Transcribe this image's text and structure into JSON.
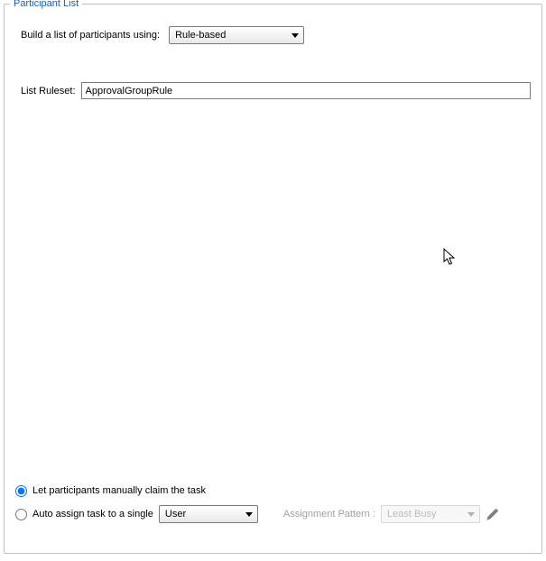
{
  "legend": "Participant List",
  "build": {
    "label": "Build a list of participants using:",
    "selected": "Rule-based"
  },
  "ruleset": {
    "label": "List Ruleset:",
    "value": "ApprovalGroupRule"
  },
  "radios": {
    "manual_label": "Let participants manually claim the task",
    "auto_label": "Auto assign task to a single",
    "auto_target_selected": "User"
  },
  "assignment": {
    "label": "Assignment Pattern :",
    "selected": "Least Busy"
  }
}
